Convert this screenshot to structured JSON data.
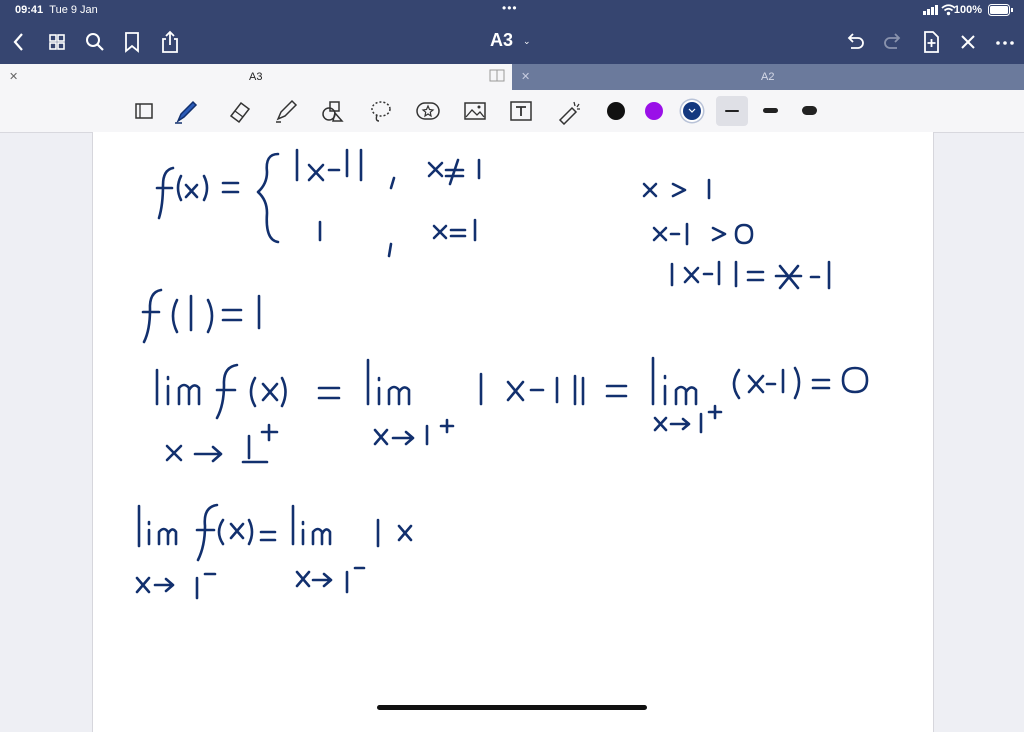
{
  "status": {
    "time": "09:41",
    "date": "Tue 9 Jan",
    "battery": "100%"
  },
  "nav": {
    "title": "A3",
    "chevron": "⌄"
  },
  "tabs": [
    {
      "label": "A3",
      "active": true
    },
    {
      "label": "A2",
      "active": false
    }
  ],
  "toolbar": {
    "tools": [
      "page-tool",
      "pen-tool",
      "eraser-tool",
      "highlighter-tool",
      "shapes-tool",
      "lasso-tool",
      "sticker-tool",
      "image-tool",
      "text-tool",
      "laser-pointer-tool"
    ],
    "colors": [
      "#111111",
      "#9a10e8",
      "#14387f"
    ],
    "stroke_widths": [
      "thin",
      "medium",
      "thick"
    ]
  },
  "colors": {
    "bar": "#364570",
    "ink": "#12306e"
  }
}
